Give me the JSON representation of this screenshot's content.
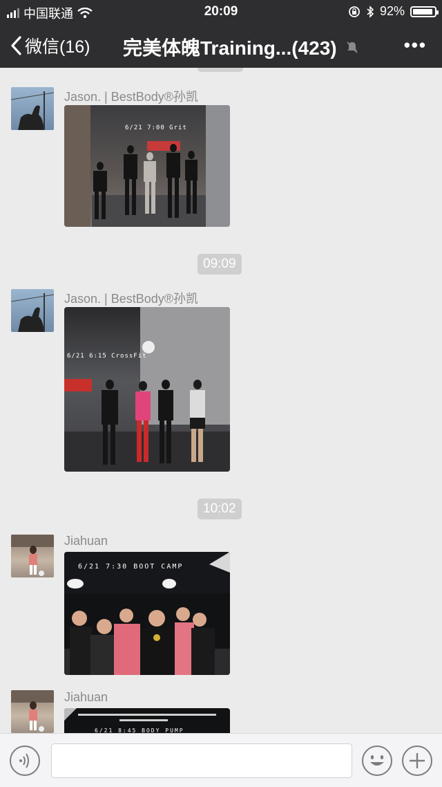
{
  "status_bar": {
    "carrier": "中国联通",
    "time": "20:09",
    "battery_percent_label": "92%",
    "battery_level": 0.92
  },
  "nav": {
    "back_label": "微信(16)",
    "chat_title": "完美体魄Training...(423)",
    "muted": true
  },
  "messages": [
    {
      "sender": "Jason. | BestBody®孙凯",
      "photo_caption": "6/21 7:00 Grit"
    },
    {
      "timestamp": "09:09"
    },
    {
      "sender": "Jason. | BestBody®孙凯",
      "photo_caption": "6/21 6:15 CrossFit"
    },
    {
      "timestamp": "10:02"
    },
    {
      "sender": "Jiahuan",
      "photo_caption": "6/21 7:30 BOOT CAMP"
    },
    {
      "sender": "Jiahuan",
      "photo_caption": "6/21 8:45 BODY PUMP"
    }
  ],
  "input": {
    "value": "",
    "placeholder": ""
  },
  "icons": [
    "back-chevron-icon",
    "mute-bell-icon",
    "more-dots-icon",
    "voice-icon",
    "emoji-icon",
    "plus-icon",
    "wifi-icon",
    "bluetooth-icon",
    "lock-rotation-icon"
  ],
  "colors": {
    "header_bg": "#2e2e30",
    "chat_bg": "#ebebeb",
    "timestamp_pill": "#cfcfcf"
  }
}
